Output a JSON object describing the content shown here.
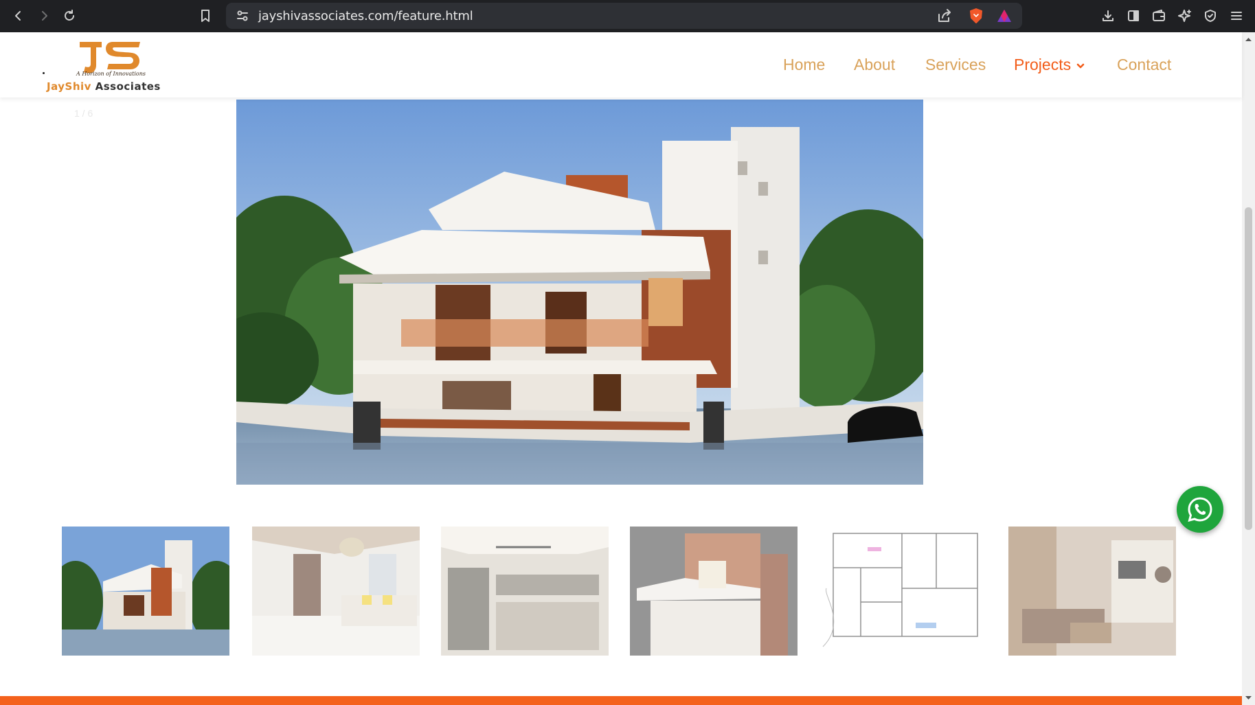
{
  "browser": {
    "url": "jayshivassociates.com/feature.html"
  },
  "site": {
    "logo": {
      "monogram": "JS",
      "tagline": "A Horizon of Innovations",
      "name_accent": "JayShiv",
      "name_rest": " Associates"
    },
    "nav": [
      {
        "label": "Home"
      },
      {
        "label": "About"
      },
      {
        "label": "Services"
      },
      {
        "label": "Projects"
      },
      {
        "label": "Contact"
      }
    ],
    "active_nav": "Projects"
  },
  "gallery": {
    "counter": "1 / 6",
    "selected_index": 0,
    "thumbnails": [
      {
        "subject": "exterior-elevation-front"
      },
      {
        "subject": "living-room-interior"
      },
      {
        "subject": "kitchen-interior"
      },
      {
        "subject": "exterior-elevation-brick"
      },
      {
        "subject": "floor-plan"
      },
      {
        "subject": "lounge-interior"
      }
    ]
  },
  "floating": {
    "chat_icon": "whatsapp-icon"
  },
  "colors": {
    "brand_orange": "#f25d1a",
    "nav_gold": "#d9a25a",
    "footer_orange": "#f4611c",
    "whatsapp_green": "#1fa53c"
  }
}
